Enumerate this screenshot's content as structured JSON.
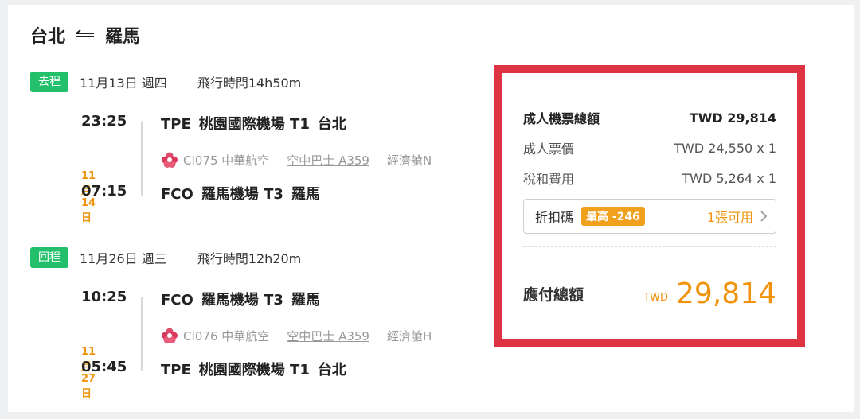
{
  "route": {
    "origin": "台北",
    "destination": "羅馬"
  },
  "outbound": {
    "tag": "去程",
    "date": "11月13日 週四",
    "duration": "飛行時間14h50m",
    "depart_time": "23:25",
    "depart_code": "TPE",
    "depart_airport": "桃園國際機場 T1",
    "depart_city": "台北",
    "flight": "CI075 中華航空",
    "aircraft": "空中巴士 A359",
    "cabin": "經濟艙N",
    "arrive_next_day": "11月14日",
    "arrive_time": "07:15",
    "arrive_code": "FCO",
    "arrive_airport": "羅馬機場 T3",
    "arrive_city": "羅馬"
  },
  "return": {
    "tag": "回程",
    "date": "11月26日 週三",
    "duration": "飛行時間12h20m",
    "depart_time": "10:25",
    "depart_code": "FCO",
    "depart_airport": "羅馬機場 T3",
    "depart_city": "羅馬",
    "flight": "CI076 中華航空",
    "aircraft": "空中巴士 A359",
    "cabin": "經濟艙H",
    "arrive_next_day": "11月27日",
    "arrive_time": "05:45",
    "arrive_code": "TPE",
    "arrive_airport": "桃園國際機場 T1",
    "arrive_city": "台北"
  },
  "price": {
    "total_label": "成人機票總額",
    "total_value": "TWD 29,814",
    "fare_label": "成人票價",
    "fare_value": "TWD 24,550 x 1",
    "tax_label": "稅和費用",
    "tax_value": "TWD 5,264 x 1",
    "coupon_label": "折扣碼",
    "coupon_badge": "最高 -246",
    "coupon_available": "1張可用",
    "grand_label": "應付總額",
    "grand_currency": "TWD",
    "grand_amount": "29,814"
  },
  "colors": {
    "tag_green": "#22c06b",
    "accent_orange": "#f0930a",
    "highlight_red": "#dd3342"
  },
  "icons": {
    "route": "round-trip-arrow-icon",
    "airline": "china-airlines-logo-icon",
    "chevron": "chevron-right-icon"
  }
}
